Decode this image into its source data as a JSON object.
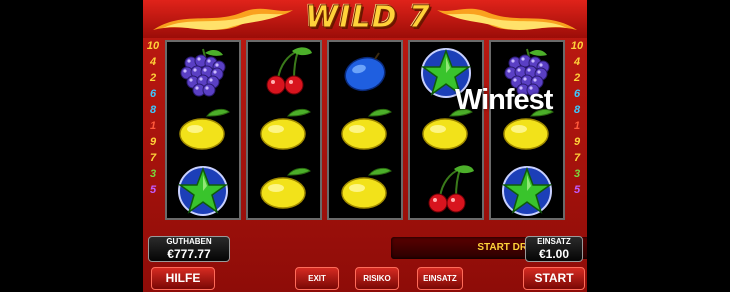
{
  "game": {
    "title": "WILD 7",
    "watermark": "Winfest"
  },
  "paylines": {
    "left": [
      "10",
      "4",
      "2",
      "6",
      "8",
      "1",
      "9",
      "7",
      "3",
      "5"
    ],
    "right": [
      "10",
      "4",
      "2",
      "6",
      "8",
      "1",
      "9",
      "7",
      "3",
      "5"
    ],
    "colors": [
      "#ffd23a",
      "#ffd23a",
      "#ffd23a",
      "#3cc8ff",
      "#3cc8ff",
      "#ff5a3c",
      "#ffd23a",
      "#ffd23a",
      "#7ad83c",
      "#c25cff"
    ]
  },
  "reels": [
    [
      "grapes",
      "lemon",
      "star"
    ],
    [
      "cherries",
      "lemon",
      "lemon"
    ],
    [
      "plum",
      "lemon",
      "lemon"
    ],
    [
      "star",
      "lemon",
      "cherries"
    ],
    [
      "grapes",
      "lemon",
      "star"
    ]
  ],
  "balance": {
    "label": "GUTHABEN",
    "value": "€777.77"
  },
  "bet": {
    "label": "EINSATZ",
    "value": "€1.00"
  },
  "status": "START DRÜCKEN",
  "buttons": {
    "help": "HILFE",
    "exit": "EXIT",
    "risk": "RISIKO",
    "stake": "EINSATZ",
    "start": "START"
  },
  "colors": {
    "frame_red": "#c01a12",
    "gold": "#ffd23a"
  }
}
